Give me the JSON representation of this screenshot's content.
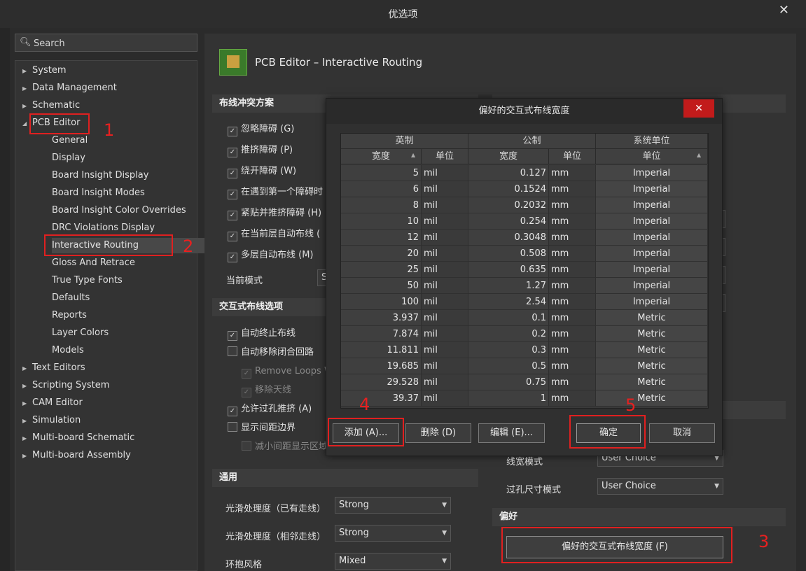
{
  "window": {
    "title": "优选项"
  },
  "search": {
    "placeholder": "Search"
  },
  "tree": {
    "root_items": [
      "System",
      "Data Management",
      "Schematic",
      "PCB Editor",
      "Text Editors",
      "Scripting System",
      "CAM Editor",
      "Simulation",
      "Multi-board Schematic",
      "Multi-board Assembly"
    ],
    "pcb_children": [
      "General",
      "Display",
      "Board Insight Display",
      "Board Insight Modes",
      "Board Insight Color Overrides",
      "DRC Violations Display",
      "Interactive Routing",
      "Gloss And Retrace",
      "True Type Fonts",
      "Defaults",
      "Reports",
      "Layer Colors",
      "Models"
    ],
    "selected": "Interactive Routing"
  },
  "annotations": {
    "n1": "1",
    "n2": "2",
    "n3": "3",
    "n4": "4",
    "n5": "5"
  },
  "page": {
    "title": "PCB Editor – Interactive Routing",
    "section_conflict": "布线冲突方案",
    "conflict_options": [
      {
        "label": "忽略障碍 (G)",
        "checked": true
      },
      {
        "label": "推挤障碍 (P)",
        "checked": true
      },
      {
        "label": "绕开障碍 (W)",
        "checked": true
      },
      {
        "label": "在遇到第一个障碍时",
        "checked": true
      },
      {
        "label": "紧贴并推挤障碍 (H)",
        "checked": true
      },
      {
        "label": "在当前层自动布线 (",
        "checked": true
      },
      {
        "label": "多层自动布线 (M)",
        "checked": true
      }
    ],
    "current_mode_label": "当前模式",
    "current_mode_value": "S",
    "section_interactive": "交互式布线选项",
    "interactive_options": [
      {
        "label": "自动终止布线",
        "checked": true,
        "disabled": false
      },
      {
        "label": "自动移除闭合回路",
        "checked": false,
        "disabled": false
      },
      {
        "label": "Remove Loops W",
        "checked": true,
        "disabled": true
      },
      {
        "label": "移除天线",
        "checked": true,
        "disabled": true
      },
      {
        "label": "允许过孔推挤 (A)",
        "checked": true,
        "disabled": false
      },
      {
        "label": "显示间距边界",
        "checked": false,
        "disabled": false
      },
      {
        "label": "减小间距显示区域",
        "checked": false,
        "disabled": true
      }
    ],
    "section_general": "通用",
    "general": [
      {
        "label": "光滑处理度（已有走线）",
        "value": "Strong"
      },
      {
        "label": "光滑处理度（相邻走线）",
        "value": "Strong"
      },
      {
        "label": "环抱风格",
        "value": "Mixed"
      }
    ],
    "width_mode_label": "线宽模式",
    "width_mode_value": "User Choice",
    "via_mode_label": "过孔尺寸模式",
    "via_mode_value": "User Choice",
    "section_pref": "偏好",
    "pref_button": "偏好的交互式布线宽度 (F)"
  },
  "dialog": {
    "title": "偏好的交互式布线宽度",
    "close": "✕",
    "group_headers": [
      "英制",
      "公制",
      "系统单位"
    ],
    "col_headers": [
      "宽度",
      "单位",
      "宽度",
      "单位",
      "单位"
    ],
    "rows": [
      [
        "5",
        "mil",
        "0.127",
        "mm",
        "Imperial"
      ],
      [
        "6",
        "mil",
        "0.1524",
        "mm",
        "Imperial"
      ],
      [
        "8",
        "mil",
        "0.2032",
        "mm",
        "Imperial"
      ],
      [
        "10",
        "mil",
        "0.254",
        "mm",
        "Imperial"
      ],
      [
        "12",
        "mil",
        "0.3048",
        "mm",
        "Imperial"
      ],
      [
        "20",
        "mil",
        "0.508",
        "mm",
        "Imperial"
      ],
      [
        "25",
        "mil",
        "0.635",
        "mm",
        "Imperial"
      ],
      [
        "50",
        "mil",
        "1.27",
        "mm",
        "Imperial"
      ],
      [
        "100",
        "mil",
        "2.54",
        "mm",
        "Imperial"
      ],
      [
        "3.937",
        "mil",
        "0.1",
        "mm",
        "Metric"
      ],
      [
        "7.874",
        "mil",
        "0.2",
        "mm",
        "Metric"
      ],
      [
        "11.811",
        "mil",
        "0.3",
        "mm",
        "Metric"
      ],
      [
        "19.685",
        "mil",
        "0.5",
        "mm",
        "Metric"
      ],
      [
        "29.528",
        "mil",
        "0.75",
        "mm",
        "Metric"
      ],
      [
        "39.37",
        "mil",
        "1",
        "mm",
        "Metric"
      ]
    ],
    "buttons": {
      "add": "添加 (A)...",
      "delete": "删除 (D)",
      "edit": "编辑 (E)...",
      "ok": "确定",
      "cancel": "取消"
    }
  }
}
